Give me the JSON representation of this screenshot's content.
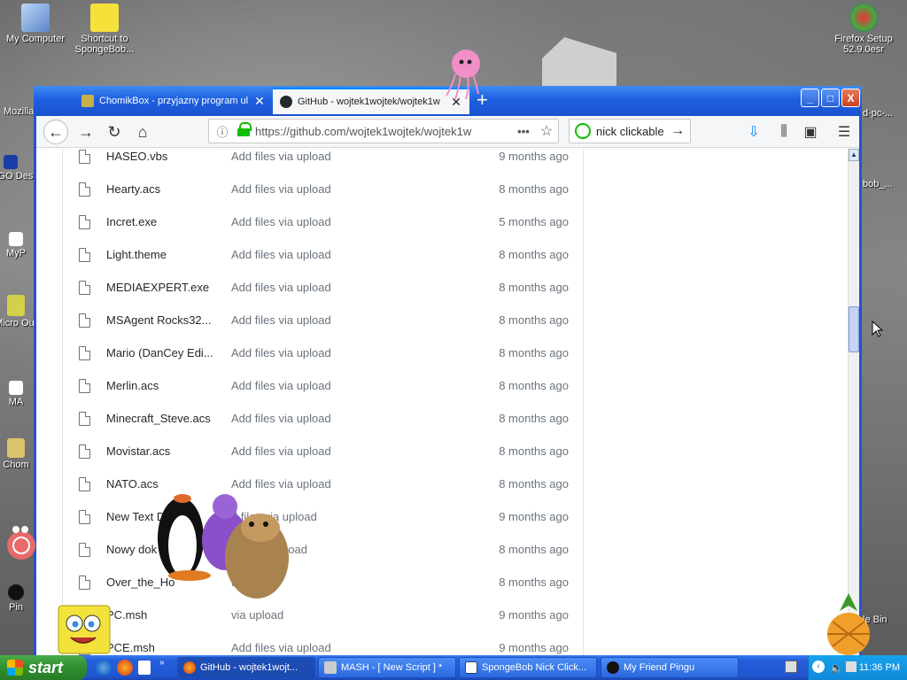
{
  "desktop": {
    "icons": [
      {
        "label": "My Computer"
      },
      {
        "label": "Shortcut to SpongeBob..."
      },
      {
        "label": "Firefox Setup 52.9.0esr"
      },
      {
        "label": "Mozilla"
      },
      {
        "label": "LEGO Desi"
      },
      {
        "label": "MyP"
      },
      {
        "label": "Micro Out"
      },
      {
        "label": "MA"
      },
      {
        "label": "Chom"
      },
      {
        "label": "Pin"
      },
      {
        "label": "d-pc-..."
      },
      {
        "label": "bob_..."
      },
      {
        "label": "le Bin"
      }
    ]
  },
  "browser": {
    "tabs": [
      {
        "title": "ChomikBox - przyjazny program ul",
        "active": false
      },
      {
        "title": "GitHub - wojtek1wojtek/wojtek1w",
        "active": true
      }
    ],
    "new_tab": "+",
    "window_buttons": {
      "minimize": "_",
      "maximize": "□",
      "close": "X"
    },
    "url": "https://github.com/wojtek1wojtek/wojtek1w",
    "url_more": "•••",
    "search_text": "nick clickable"
  },
  "files": [
    {
      "name": "HASEO.vbs",
      "message": "Add files via upload",
      "age": "9 months ago"
    },
    {
      "name": "Hearty.acs",
      "message": "Add files via upload",
      "age": "8 months ago"
    },
    {
      "name": "Incret.exe",
      "message": "Add files via upload",
      "age": "5 months ago"
    },
    {
      "name": "Light.theme",
      "message": "Add files via upload",
      "age": "8 months ago"
    },
    {
      "name": "MEDIAEXPERT.exe",
      "message": "Add files via upload",
      "age": "8 months ago"
    },
    {
      "name": "MSAgent Rocks32...",
      "message": "Add files via upload",
      "age": "8 months ago"
    },
    {
      "name": "Mario (DanCey Edi...",
      "message": "Add files via upload",
      "age": "8 months ago"
    },
    {
      "name": "Merlin.acs",
      "message": "Add files via upload",
      "age": "8 months ago"
    },
    {
      "name": "Minecraft_Steve.acs",
      "message": "Add files via upload",
      "age": "8 months ago"
    },
    {
      "name": "Movistar.acs",
      "message": "Add files via upload",
      "age": "8 months ago"
    },
    {
      "name": "NATO.acs",
      "message": "Add files via upload",
      "age": "8 months ago"
    },
    {
      "name": "New Text D...",
      "message": "d files via upload",
      "age": "9 months ago"
    },
    {
      "name": "Nowy dok",
      "message": "files via upload",
      "age": "8 months ago"
    },
    {
      "name": "Over_the_Ho",
      "message": "upload",
      "age": "8 months ago"
    },
    {
      "name": "PC.msh",
      "message": "via upload",
      "age": "9 months ago"
    },
    {
      "name": "PCE.msh",
      "message": "Add files via upload",
      "age": "9 months ago"
    }
  ],
  "taskbar": {
    "start_label": "start",
    "buttons": [
      {
        "label": "GitHub - wojtek1wojt...",
        "active": true
      },
      {
        "label": "MASH - [ New Script ] *",
        "active": false
      },
      {
        "label": "SpongeBob Nick Click...",
        "active": false
      },
      {
        "label": "My Friend Pingu",
        "active": false
      }
    ],
    "clock": "11:36 PM"
  },
  "colors": {
    "xp_blue": "#245edb",
    "start_green": "#2f8f2f",
    "secure_green": "#12bc00",
    "link_blue": "#0a84ff"
  }
}
